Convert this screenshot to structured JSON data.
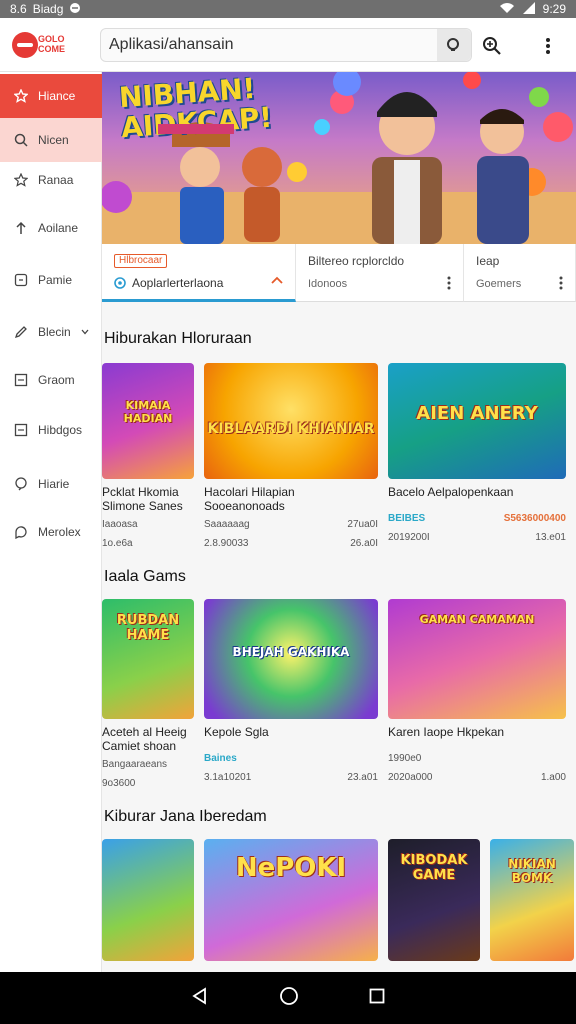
{
  "status_bar": {
    "left_text": "8.6",
    "carrier": "Biadg",
    "time": "9:29"
  },
  "app": {
    "logo_text": "GOLO COME",
    "search_value": "Aplikasi/ahansain"
  },
  "sidebar": {
    "items": [
      {
        "label": "Hiance",
        "icon": "star-icon"
      },
      {
        "label": "Nicen",
        "icon": "search-icon"
      },
      {
        "label": "Ranaa",
        "icon": "bookmark-star-icon"
      },
      {
        "label": "Aoilane",
        "icon": "upload-icon"
      },
      {
        "label": "Pamie",
        "icon": "puzzle-icon"
      },
      {
        "label": "Blecin",
        "icon": "pencil-icon"
      },
      {
        "label": "Graom",
        "icon": "square-icon"
      },
      {
        "label": "Hibdgos",
        "icon": "grid-icon"
      },
      {
        "label": "Hiarie",
        "icon": "chat-icon"
      },
      {
        "label": "Merolex",
        "icon": "bubble-icon"
      }
    ]
  },
  "banner": {
    "title_line1": "NIBHAN!",
    "title_line2": "AIDKCAP!"
  },
  "tiles": {
    "t1": {
      "chip": "Hlbrocaar",
      "label": "Aoplarlerterlaona"
    },
    "t2": {
      "title": "Biltereo rcplorcldo",
      "sub": "Idonoos"
    },
    "t3": {
      "title": "Ieap",
      "sub": "Goemers"
    }
  },
  "sections": [
    {
      "title": "Hiburakan Hloruraan",
      "cards": [
        {
          "thumb_text": "KIMAIA HADIAN",
          "name1": "Pcklat Hkomia",
          "name2": "Slimone Sanes",
          "a": "Iaaoasa",
          "b": "",
          "c": "1o.e6a",
          "d": ""
        },
        {
          "thumb_text": "KIBLAARDI KHIANIAR",
          "name1": "Hacolari Hilapian",
          "name2": "Sooeanonoads",
          "a": "Saaaaaag",
          "b": "27ua0I",
          "c": "2.8.90033",
          "d": "26.a0I"
        },
        {
          "thumb_text": "AIEN ANERY",
          "name1": "Bacelo Aelpalopenkaan",
          "name2": "",
          "a": "BEIBES",
          "b": "S5636000400",
          "c": "2019200I",
          "d": "13.e01"
        }
      ]
    },
    {
      "title": "Iaala Gams",
      "cards": [
        {
          "thumb_text": "RUBDAN HAME",
          "name1": "Aceteh al Heeig",
          "name2": "Camiet shoan",
          "a": "Bangaaraeans",
          "b": "",
          "c": "9o3600",
          "d": ""
        },
        {
          "thumb_text": "BHEJAH GAKHIKA",
          "name1": "Kepole Sgla",
          "name2": "",
          "a": "Baines",
          "b": "",
          "c": "3.1a10201",
          "d": "23.a01"
        },
        {
          "thumb_text": "GAMAN CAMAMAN",
          "name1": "Karen Iaope Hkpekan",
          "name2": "",
          "a": "1990e0",
          "b": "",
          "c": "2020a000",
          "d": "1.a00"
        }
      ]
    },
    {
      "title": "Kiburar Jana Iberedam",
      "cards": [
        {
          "thumb_text": "",
          "name1": "",
          "name2": "",
          "a": "",
          "b": "",
          "c": "",
          "d": ""
        },
        {
          "thumb_text": "NePOKI",
          "name1": "",
          "name2": "",
          "a": "",
          "b": "",
          "c": "",
          "d": ""
        },
        {
          "thumb_text": "KIBODAK GAME",
          "name1": "",
          "name2": "",
          "a": "",
          "b": "",
          "c": "",
          "d": ""
        },
        {
          "thumb_text": "NIKIAN BOMK",
          "name1": "",
          "name2": "",
          "a": "",
          "b": "",
          "c": "",
          "d": ""
        }
      ]
    }
  ],
  "colors": {
    "accent": "#ea4a3d",
    "active_light": "#fbd6d1",
    "link_blue": "#2aa8c8",
    "orange": "#e5703a"
  }
}
